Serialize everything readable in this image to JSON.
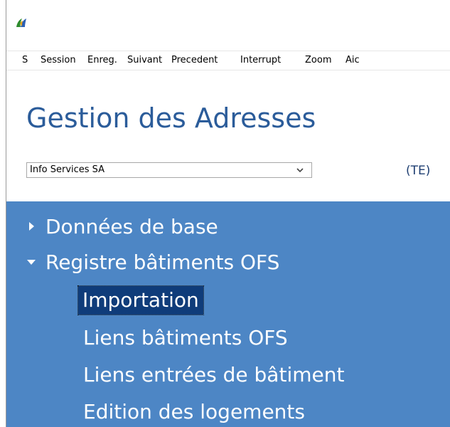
{
  "menubar": {
    "items": [
      "S",
      "Session",
      "Enreg.",
      "Suivant",
      "Precedent",
      "Interrupt",
      "Zoom",
      "Aic"
    ]
  },
  "page": {
    "title": "Gestion des Adresses"
  },
  "company_select": {
    "value": "Info Services  SA",
    "code": "(TE)"
  },
  "nav": {
    "items": [
      {
        "label": "Données de base",
        "state": "collapsed"
      },
      {
        "label": "Registre bâtiments OFS",
        "state": "expanded"
      }
    ],
    "subitems": [
      {
        "label": "Importation"
      },
      {
        "label": "Liens bâtiments OFS"
      },
      {
        "label": "Liens entrées de bâtiment"
      },
      {
        "label": "Edition des logements"
      }
    ],
    "selected": "Importation"
  },
  "colors": {
    "nav_bg": "#4d86c5",
    "title": "#2b5c9a",
    "selected_bg": "#0f3c7a"
  },
  "icons": {
    "app": "app-logo-icon",
    "dropdown": "chevron-down-icon",
    "collapsed": "triangle-right-icon",
    "expanded": "triangle-down-icon"
  }
}
